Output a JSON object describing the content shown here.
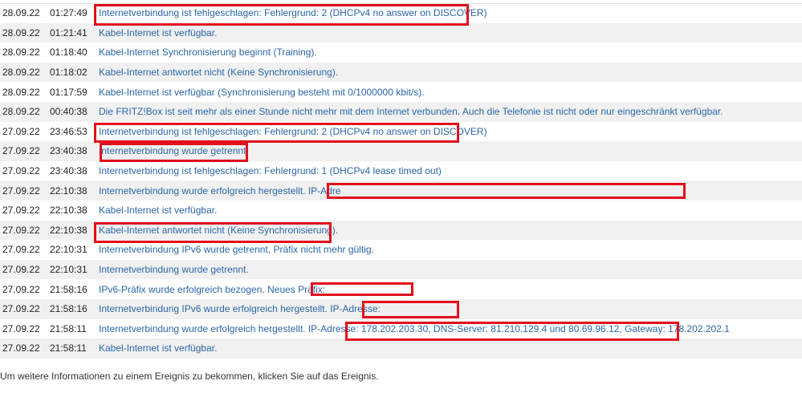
{
  "events": [
    {
      "date": "28.09.22",
      "time": "01:27:49",
      "message": "Internetverbindung ist fehlgeschlagen: Fehlergrund: 2 (DHCPv4 no answer on DISCOVER)"
    },
    {
      "date": "28.09.22",
      "time": "01:21:41",
      "message": "Kabel-Internet ist verfügbar."
    },
    {
      "date": "28.09.22",
      "time": "01:18:40",
      "message": "Kabel-Internet Synchronisierung beginnt (Training)."
    },
    {
      "date": "28.09.22",
      "time": "01:18:02",
      "message": "Kabel-Internet antwortet nicht (Keine Synchronisierung)."
    },
    {
      "date": "28.09.22",
      "time": "01:17:59",
      "message": "Kabel-Internet ist verfügbar (Synchronisierung besteht mit 0/1000000 kbit/s)."
    },
    {
      "date": "28.09.22",
      "time": "00:40:38",
      "message": "Die FRITZ!Box ist seit mehr als einer Stunde nicht mehr mit dem Internet verbunden. Auch die Telefonie ist nicht oder nur eingeschränkt verfügbar."
    },
    {
      "date": "27.09.22",
      "time": "23:46:53",
      "message": "Internetverbindung ist fehlgeschlagen: Fehlergrund: 2 (DHCPv4 no answer on DISCOVER)"
    },
    {
      "date": "27.09.22",
      "time": "23:40:38",
      "message": "Internetverbindung wurde getrennt."
    },
    {
      "date": "27.09.22",
      "time": "23:40:38",
      "message": "Internetverbindung ist fehlgeschlagen: Fehlergrund: 1 (DHCPv4 lease timed out)"
    },
    {
      "date": "27.09.22",
      "time": "22:10:38",
      "message": "Internetverbindung wurde erfolgreich hergestellt. IP-Adre"
    },
    {
      "date": "27.09.22",
      "time": "22:10:38",
      "message": "Kabel-Internet ist verfügbar."
    },
    {
      "date": "27.09.22",
      "time": "22:10:38",
      "message": "Kabel-Internet antwortet nicht (Keine Synchronisierung)."
    },
    {
      "date": "27.09.22",
      "time": "22:10:31",
      "message": "Internetverbindung IPv6 wurde getrennt, Präfix nicht mehr gültig."
    },
    {
      "date": "27.09.22",
      "time": "22:10:31",
      "message": "Internetverbindung wurde getrennt."
    },
    {
      "date": "27.09.22",
      "time": "21:58:16",
      "message": "IPv6-Präfix wurde erfolgreich bezogen. Neues Präfix:"
    },
    {
      "date": "27.09.22",
      "time": "21:58:16",
      "message": "Internetverbindung IPv6 wurde erfolgreich hergestellt. IP-Adresse:"
    },
    {
      "date": "27.09.22",
      "time": "21:58:11",
      "message": "Internetverbindung wurde erfolgreich hergestellt. IP-Adresse: 178.202.203.30, DNS-Server: 81.210.129.4 und 80.69.96.12, Gateway: 178.202.202.1"
    },
    {
      "date": "27.09.22",
      "time": "21:58:11",
      "message": "Kabel-Internet ist verfügbar."
    }
  ],
  "footer": {
    "note": "Um weitere Informationen zu einem Ereignis zu bekommen, klicken Sie auf das Ereignis."
  },
  "annotation_color": "#e0101c"
}
